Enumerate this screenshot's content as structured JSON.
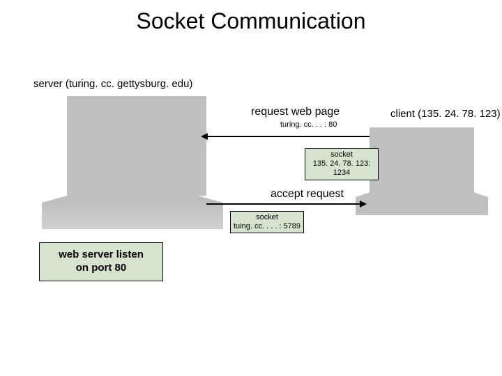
{
  "title": "Socket Communication",
  "server": {
    "label": "server (turing. cc. gettysburg. edu)"
  },
  "client": {
    "label": "client (135. 24. 78. 123)"
  },
  "request": {
    "label": "request web page",
    "port": "turing. cc. . . : 80"
  },
  "client_socket": {
    "line1": "socket",
    "line2": "135. 24. 78. 123: 1234"
  },
  "accept": {
    "label": "accept request"
  },
  "server_socket": {
    "line1": "socket",
    "line2": "tuing. cc. . . . : 5789"
  },
  "listen": {
    "line1": "web server listen",
    "line2": "on port 80"
  }
}
